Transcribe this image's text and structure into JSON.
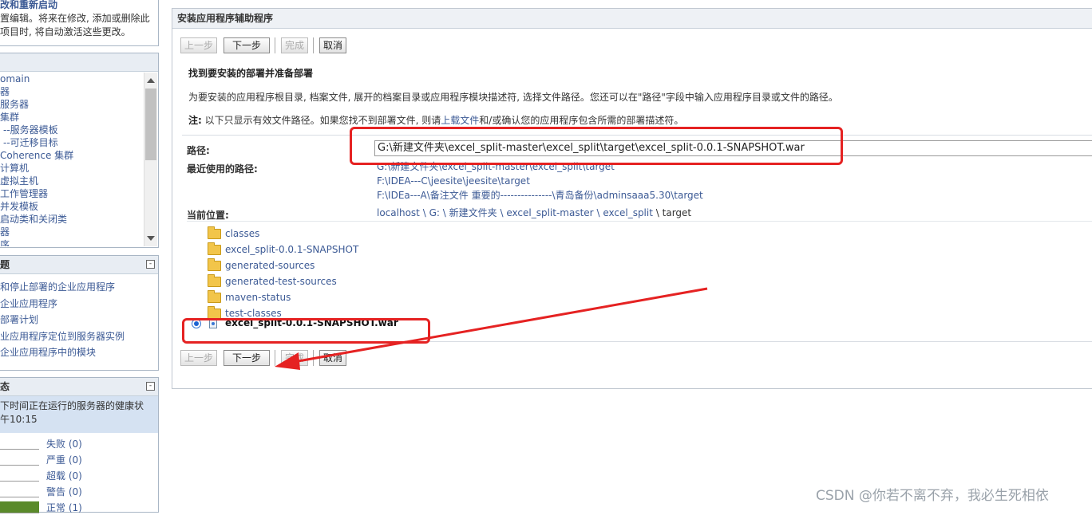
{
  "left": {
    "help": {
      "title": "改和重新启动",
      "line1": "置编辑。将来在修改, 添加或删除此",
      "line2": "项目时, 将自动激活这些更改。"
    },
    "tree": {
      "items": [
        {
          "label": "omain"
        },
        {
          "label": "器"
        },
        {
          "label": "服务器"
        },
        {
          "label": "集群"
        },
        {
          "label": "--服务器模板"
        },
        {
          "label": "--可迁移目标"
        },
        {
          "label": "Coherence 集群"
        },
        {
          "label": "计算机"
        },
        {
          "label": "虚拟主机"
        },
        {
          "label": "工作管理器"
        },
        {
          "label": "并发模板"
        },
        {
          "label": "启动类和关闭类"
        },
        {
          "label": "器"
        },
        {
          "label": "序"
        }
      ]
    },
    "howto": {
      "title": "题",
      "toggle": "-",
      "items": [
        {
          "label": "和停止部署的企业应用程序"
        },
        {
          "label": "企业应用程序"
        },
        {
          "label": "部署计划"
        },
        {
          "label": "业应用程序定位到服务器实例"
        },
        {
          "label": "企业应用程序中的模块"
        }
      ]
    },
    "status": {
      "title": "态",
      "toggle": "-",
      "desc1": "下时间正在运行的服务器的健康状",
      "desc2": "午10:15",
      "rows": [
        {
          "label": "失败 (0)",
          "level": 0
        },
        {
          "label": "严重 (0)",
          "level": 0
        },
        {
          "label": "超载 (0)",
          "level": 0
        },
        {
          "label": "警告 (0)",
          "level": 0
        },
        {
          "label": "正常 (1)",
          "level": 1,
          "color": "#5a8a2a"
        }
      ]
    }
  },
  "main": {
    "title": "安装应用程序辅助程序",
    "buttons": {
      "back": "上一步",
      "next": "下一步",
      "finish": "完成",
      "cancel": "取消"
    },
    "section_title": "找到要安装的部署并准备部署",
    "description": "为要安装的应用程序根目录, 档案文件, 展开的档案目录或应用程序模块描述符, 选择文件路径。您还可以在\"路径\"字段中输入应用程序目录或文件的路径。",
    "note_label": "注:",
    "note_text_1": "以下只显示有效文件路径。如果您找不到部署文件, 则请",
    "note_link": "上载文件",
    "note_text_2": "和/或确认您的应用程序包含所需的部署描述符。",
    "path_label": "路径:",
    "path_value": "G:\\新建文件夹\\excel_split-master\\excel_split\\target\\excel_split-0.0.1-SNAPSHOT.war",
    "recent_label": "最近使用的路径:",
    "recent_paths": [
      {
        "path": "G:\\新建文件夹\\excel_split-master\\excel_split\\target"
      },
      {
        "path": "F:\\IDEA---C\\jeesite\\jeesite\\target"
      },
      {
        "path": "F:\\IDEa---A\\备注文件 重要的---------------\\青岛备份\\adminsaaa5.30\\target"
      }
    ],
    "location_label": "当前位置:",
    "location": {
      "p1": "localhost",
      "p2": "G:",
      "p3": "新建文件夹",
      "p4": "excel_split-master",
      "p5": "excel_split",
      "current": "target",
      "sep": "\\"
    },
    "folders": [
      {
        "name": "classes"
      },
      {
        "name": "excel_split-0.0.1-SNAPSHOT"
      },
      {
        "name": "generated-sources"
      },
      {
        "name": "generated-test-sources"
      },
      {
        "name": "maven-status"
      },
      {
        "name": "test-classes"
      }
    ],
    "selected_file": "excel_split-0.0.1-SNAPSHOT.war"
  },
  "annotation_color": "#e52222",
  "watermark": "CSDN @你若不离不弃，我必生死相依"
}
